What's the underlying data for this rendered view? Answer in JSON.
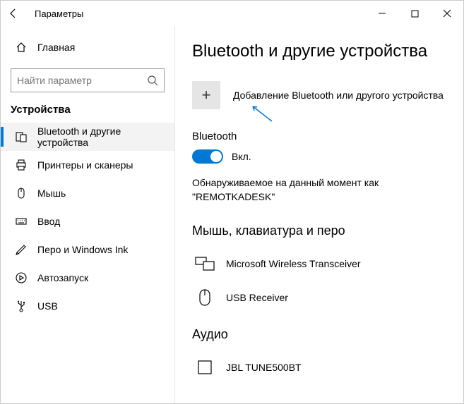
{
  "window": {
    "title": "Параметры"
  },
  "sidebar": {
    "home_label": "Главная",
    "search_placeholder": "Найти параметр",
    "section_label": "Устройства",
    "items": [
      {
        "label": "Bluetooth и другие устройства"
      },
      {
        "label": "Принтеры и сканеры"
      },
      {
        "label": "Мышь"
      },
      {
        "label": "Ввод"
      },
      {
        "label": "Перо и Windows Ink"
      },
      {
        "label": "Автозапуск"
      },
      {
        "label": "USB"
      }
    ]
  },
  "main": {
    "title": "Bluetooth и другие устройства",
    "add_label": "Добавление Bluetooth или другого устройства",
    "bt_label": "Bluetooth",
    "bt_toggle_state": "Вкл.",
    "discoverable_text": "Обнаруживаемое на данный момент как \"REMOTKADESK\"",
    "group1_title": "Мышь, клавиатура и перо",
    "device1": "Microsoft Wireless Transceiver",
    "device2": "USB Receiver",
    "group2_title": "Аудио",
    "device3": "JBL TUNE500BT"
  }
}
